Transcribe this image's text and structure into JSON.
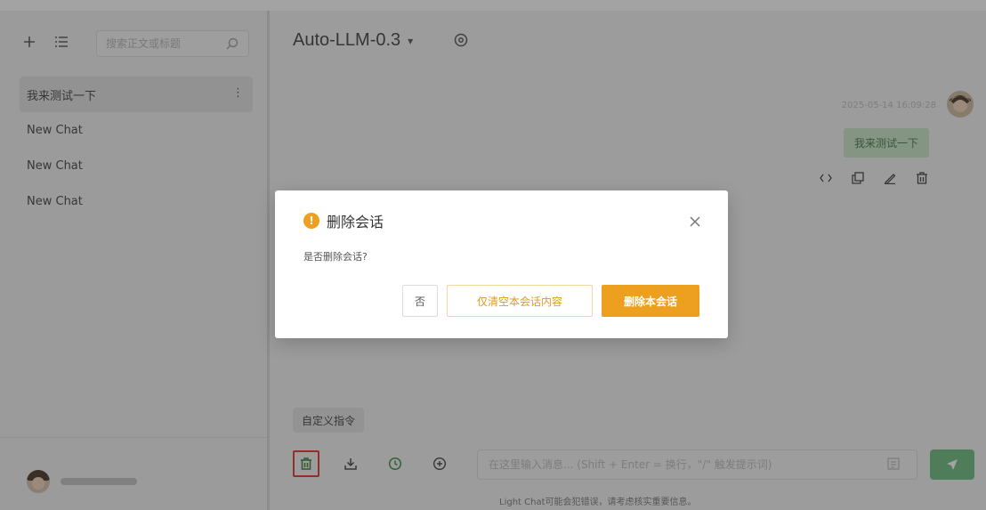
{
  "sidebar": {
    "search_placeholder": "搜索正文或标题",
    "chats": [
      {
        "label": "我来测试一下",
        "active": true,
        "more": "⋮"
      },
      {
        "label": "New Chat",
        "active": false
      },
      {
        "label": "New Chat",
        "active": false
      },
      {
        "label": "New Chat",
        "active": false
      }
    ],
    "username": "user"
  },
  "main": {
    "model_name": "Auto-LLM-0.3",
    "model_caret": "▾",
    "message": {
      "time": "2025-05-14 16:09:28",
      "text": "我来测试一下"
    },
    "prompt_chip": "自定义指令",
    "input_placeholder": "在这里输入消息... (Shift + Enter = 换行，\"/\" 触发提示词)",
    "disclaimer": "Light Chat可能会犯错误，请考虑核实重要信息。"
  },
  "dialog": {
    "title": "删除会话",
    "warn_glyph": "!",
    "message": "是否删除会话?",
    "btn_no": "否",
    "btn_clear": "仅清空本会话内容",
    "btn_delete": "删除本会话"
  },
  "colors": {
    "accent": "#eda020",
    "send": "#7dc48b",
    "bubble": "#cfe9cf",
    "highlight": "#e64a3b"
  }
}
